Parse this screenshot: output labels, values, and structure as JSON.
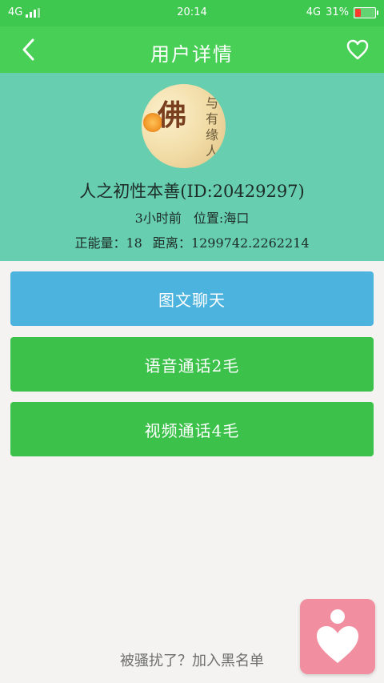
{
  "status_bar": {
    "left_network": "4G",
    "time": "20:14",
    "right_network": "4G",
    "battery_text": "31%",
    "battery_level": 0.31
  },
  "navbar": {
    "title": "用户详情",
    "back_icon": "chevron-left",
    "favorite_icon": "heart-outline"
  },
  "profile": {
    "avatar_text_big": "佛",
    "avatar_text_small": "与有缘人",
    "name_line": "人之初性本善(ID:20429297)",
    "meta_line": "3小时前 位置:海口",
    "stats_line": "正能量：18 距离：1299742.2262214"
  },
  "actions": {
    "chat_label": "图文聊天",
    "voice_label": "语音通话2毛",
    "video_label": "视频通话4毛"
  },
  "footer": {
    "blacklist_text": "被骚扰了？加入黑名单"
  },
  "colors": {
    "status_bar": "#3ec84f",
    "navbar": "#48cf55",
    "profile_bg": "#67cfaf",
    "chat_button": "#4bb3dd",
    "voice_button": "#3cc24a",
    "video_button": "#3cc24a",
    "float_button": "#f18ea0",
    "page_bg": "#f4f3f1"
  }
}
